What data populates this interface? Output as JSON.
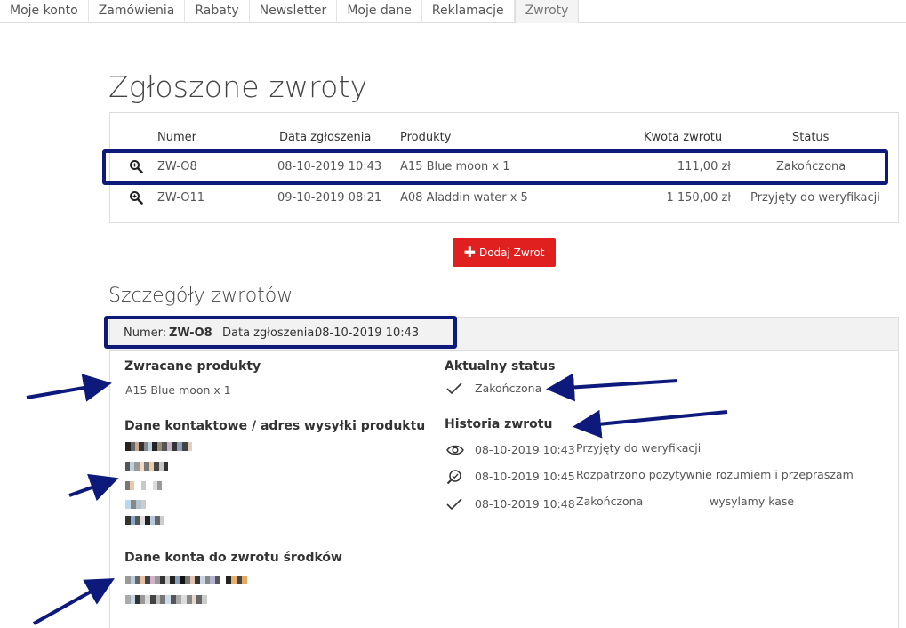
{
  "tabs": [
    {
      "label": "Moje konto"
    },
    {
      "label": "Zamówienia"
    },
    {
      "label": "Rabaty"
    },
    {
      "label": "Newsletter"
    },
    {
      "label": "Moje dane"
    },
    {
      "label": "Reklamacje"
    },
    {
      "label": "Zwroty",
      "active": true
    }
  ],
  "page_title": "Zgłoszone zwroty",
  "returns_table": {
    "headers": {
      "numer": "Numer",
      "data": "Data zgłoszenia",
      "produkty": "Produkty",
      "kwota": "Kwota zwrotu",
      "status": "Status"
    },
    "rows": [
      {
        "numer": "ZW-O8",
        "data": "08-10-2019 10:43",
        "produkty": "A15 Blue moon x 1",
        "kwota": "111,00 zł",
        "status": "Zakończona"
      },
      {
        "numer": "ZW-O11",
        "data": "09-10-2019 08:21",
        "produkty": "A08 Aladdin water x 5",
        "kwota": "1 150,00 zł",
        "status": "Przyjęty do weryfikacji"
      }
    ]
  },
  "add_button": {
    "label": "Dodaj Zwrot",
    "icon": "plus-icon"
  },
  "details": {
    "section_title": "Szczegóły zwrotów",
    "header": {
      "numer_label": "Numer:",
      "numer_value": "ZW-O8",
      "data_label": "Data zgłoszenia:",
      "data_value": "08-10-2019 10:43"
    },
    "products": {
      "title": "Zwracane produkty",
      "item": "A15 Blue moon x 1"
    },
    "contact": {
      "title": "Dane kontaktowe / adres wysyłki produktu"
    },
    "account": {
      "title": "Dane konta do zwrotu środków"
    },
    "current_status": {
      "title": "Aktualny status",
      "value": "Zakończona"
    },
    "history": {
      "title": "Historia zwrotu",
      "entries": [
        {
          "icon": "eye-icon",
          "date": "08-10-2019 10:43",
          "text": "Przyjęty do weryfikacji",
          "note": ""
        },
        {
          "icon": "search-check-icon",
          "date": "08-10-2019 10:45",
          "text": "Rozpatrzono pozytywnie rozumiem i przepraszam",
          "note": ""
        },
        {
          "icon": "check-icon",
          "date": "08-10-2019 10:48",
          "text": "Zakończona",
          "note": "wysylamy kase"
        }
      ]
    }
  },
  "colors": {
    "accent_red": "#e0201f",
    "annotation_blue": "#0d1a7c"
  }
}
